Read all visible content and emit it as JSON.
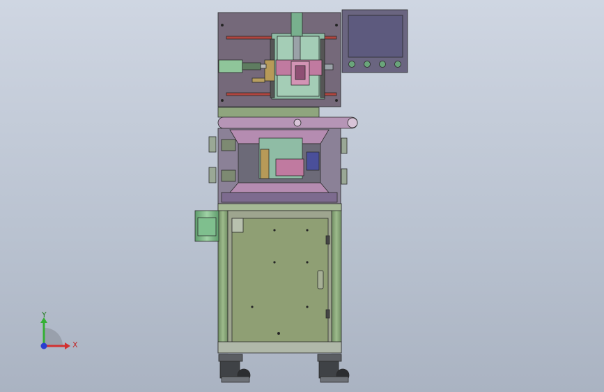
{
  "viewport": {
    "triad": {
      "x_label": "X",
      "y_label": "Y"
    }
  },
  "colors": {
    "background_top": "#cfd6e2",
    "background_bottom": "#aab3c2",
    "frame_green": "#86a476",
    "upper_plate": "#75697a",
    "lower_panel": "#8f9f74",
    "teal_part": "#8fbca5",
    "pink_part": "#c07aa0",
    "hmi_screen": "#5d5a7e",
    "hmi_button": "#6aa57b",
    "axis_x": "#d23030",
    "axis_y": "#34b034",
    "axis_z": "#2a3fd0"
  },
  "icons": {
    "coordinate_triad": "xyz-triad-icon"
  }
}
